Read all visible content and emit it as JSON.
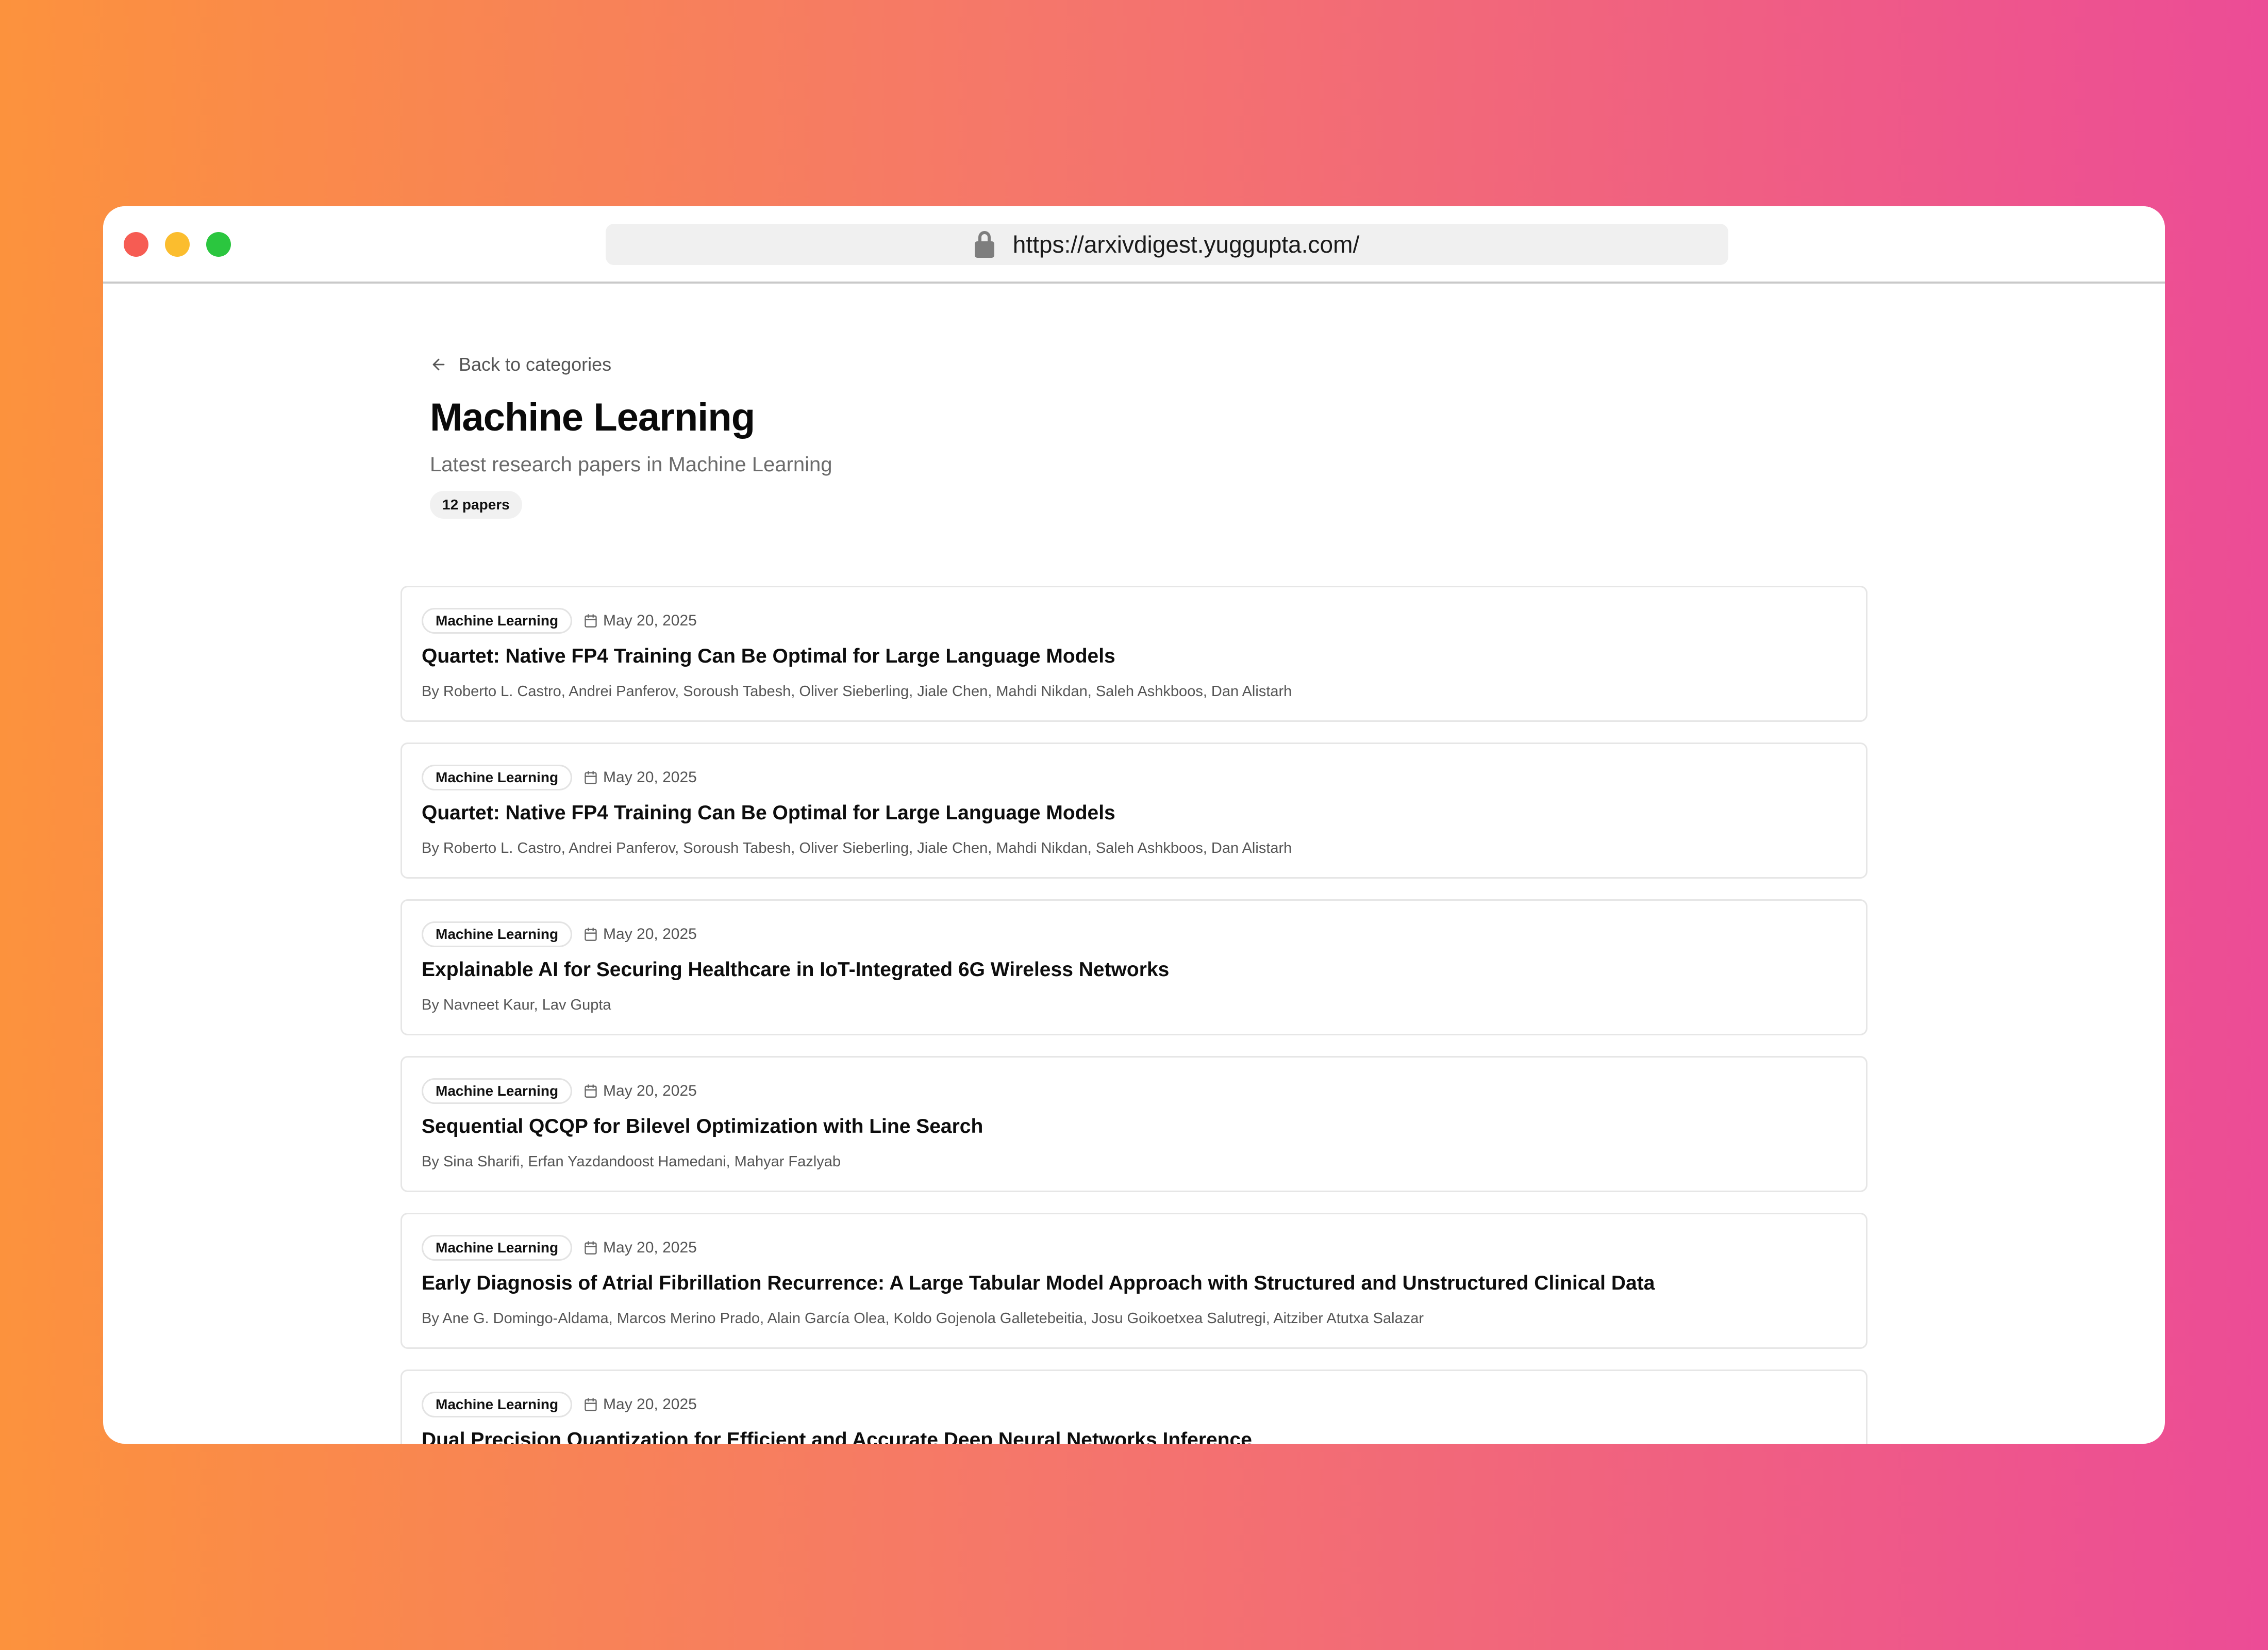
{
  "browser": {
    "url": "https://arxivdigest.yuggupta.com/"
  },
  "page": {
    "back_label": "Back to categories",
    "title": "Machine Learning",
    "subtitle": "Latest research papers in Machine Learning",
    "count_label": "12 papers"
  },
  "papers": [
    {
      "category": "Machine Learning",
      "date": "May 20, 2025",
      "title": "Quartet: Native FP4 Training Can Be Optimal for Large Language Models",
      "authors": "By Roberto L. Castro, Andrei Panferov, Soroush Tabesh, Oliver Sieberling, Jiale Chen, Mahdi Nikdan, Saleh Ashkboos, Dan Alistarh"
    },
    {
      "category": "Machine Learning",
      "date": "May 20, 2025",
      "title": "Quartet: Native FP4 Training Can Be Optimal for Large Language Models",
      "authors": "By Roberto L. Castro, Andrei Panferov, Soroush Tabesh, Oliver Sieberling, Jiale Chen, Mahdi Nikdan, Saleh Ashkboos, Dan Alistarh"
    },
    {
      "category": "Machine Learning",
      "date": "May 20, 2025",
      "title": "Explainable AI for Securing Healthcare in IoT-Integrated 6G Wireless Networks",
      "authors": "By Navneet Kaur, Lav Gupta"
    },
    {
      "category": "Machine Learning",
      "date": "May 20, 2025",
      "title": "Sequential QCQP for Bilevel Optimization with Line Search",
      "authors": "By Sina Sharifi, Erfan Yazdandoost Hamedani, Mahyar Fazlyab"
    },
    {
      "category": "Machine Learning",
      "date": "May 20, 2025",
      "title": "Early Diagnosis of Atrial Fibrillation Recurrence: A Large Tabular Model Approach with Structured and Unstructured Clinical Data",
      "authors": "By Ane G. Domingo-Aldama, Marcos Merino Prado, Alain García Olea, Koldo Gojenola Galletebeitia, Josu Goikoetxea Salutregi, Aitziber Atutxa Salazar"
    },
    {
      "category": "Machine Learning",
      "date": "May 20, 2025",
      "title": "Dual Precision Quantization for Efficient and Accurate Deep Neural Networks Inference",
      "authors": ""
    }
  ]
}
